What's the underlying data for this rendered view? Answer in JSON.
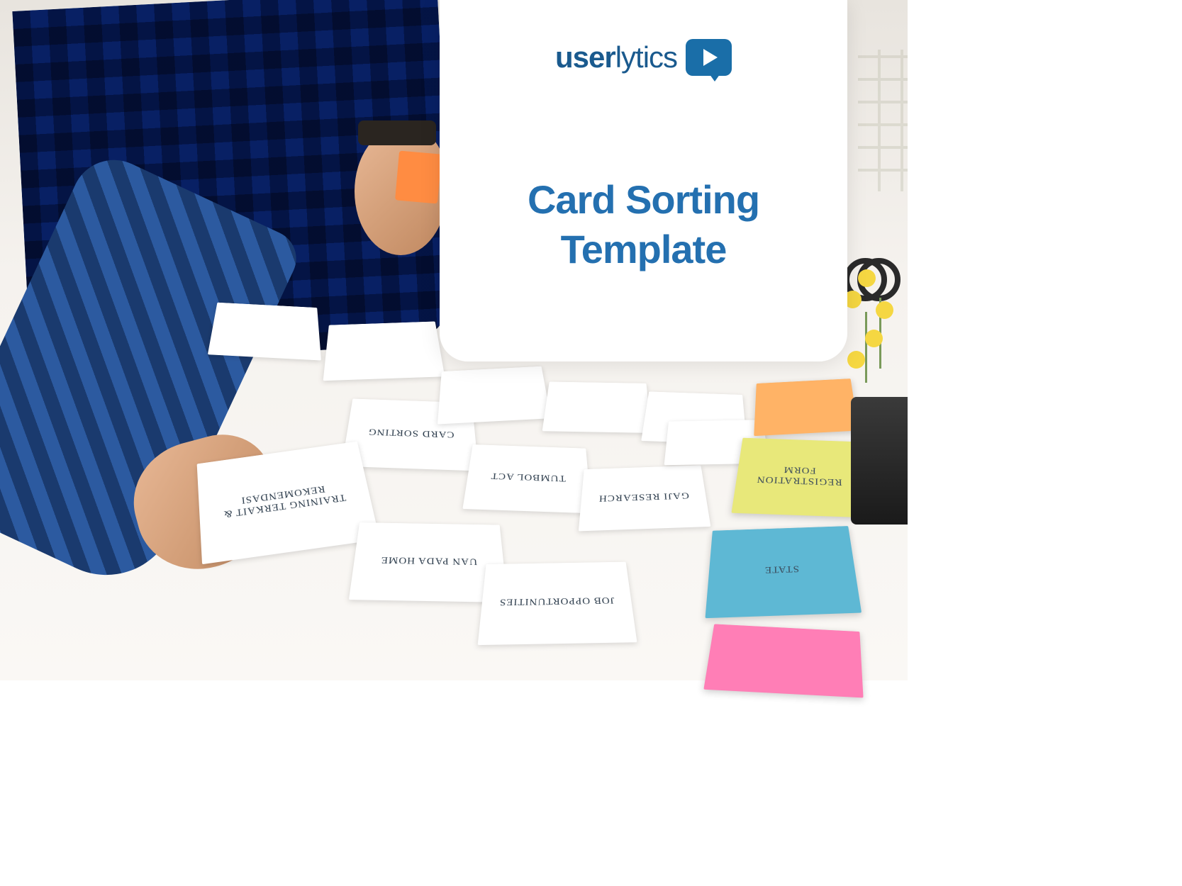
{
  "brand": {
    "name_bold": "user",
    "name_light": "lytics",
    "icon": "play-bubble-icon"
  },
  "panel": {
    "title": "Card Sorting Template"
  },
  "cards": {
    "held": "TRAINING TERKAIT & REKOMENDASI",
    "c3": "CARD SORTING",
    "c4": "UAN PADA HOME",
    "c6": "TUMBOL ACT",
    "c7": "JOB OPPORTUNITIES",
    "c9": "GAJI RESEARCH"
  },
  "stickies": {
    "yellow": "REGISTRATION FORM",
    "blue": "STATE"
  }
}
